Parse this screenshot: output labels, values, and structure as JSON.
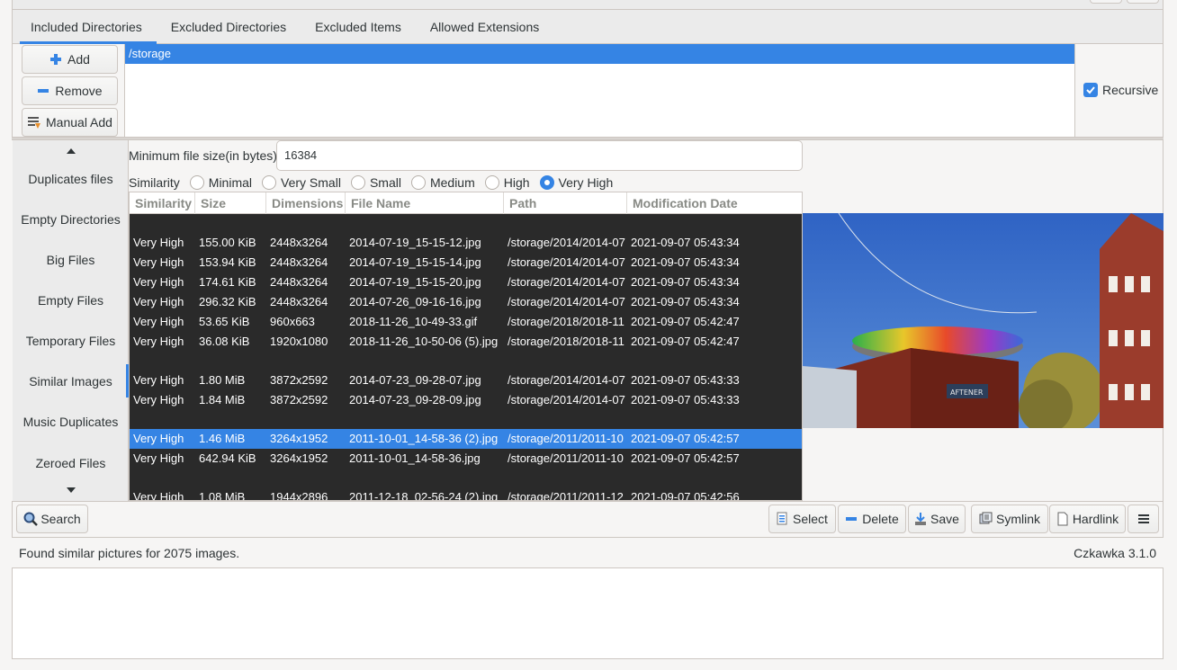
{
  "tabs": [
    "Included Directories",
    "Excluded Directories",
    "Excluded Items",
    "Allowed Extensions"
  ],
  "dir_buttons": {
    "add": "Add",
    "remove": "Remove",
    "manual_add": "Manual Add"
  },
  "directories": [
    "/storage"
  ],
  "recursive_label": "Recursive",
  "sidebar": {
    "items": [
      "Duplicates files",
      "Empty Directories",
      "Big Files",
      "Empty Files",
      "Temporary Files",
      "Similar Images",
      "Music Duplicates",
      "Zeroed Files"
    ],
    "active": "Similar Images"
  },
  "min_size": {
    "label": "Minimum file size(in bytes)",
    "value": "16384"
  },
  "similarity": {
    "label": "Similarity",
    "options": [
      "Minimal",
      "Very Small",
      "Small",
      "Medium",
      "High",
      "Very High"
    ],
    "selected": "Very High"
  },
  "table": {
    "columns": [
      "Similarity",
      "Size",
      "Dimensions",
      "File Name",
      "Path",
      "Modification Date"
    ],
    "rows": [
      {
        "sep": true
      },
      {
        "sim": "Very High",
        "size": "155.00 KiB",
        "dim": "2448x3264",
        "name": "2014-07-19_15-15-12.jpg",
        "path": "/storage/2014/2014-07",
        "date": "2021-09-07 05:43:34"
      },
      {
        "sim": "Very High",
        "size": "153.94 KiB",
        "dim": "2448x3264",
        "name": "2014-07-19_15-15-14.jpg",
        "path": "/storage/2014/2014-07",
        "date": "2021-09-07 05:43:34"
      },
      {
        "sim": "Very High",
        "size": "174.61 KiB",
        "dim": "2448x3264",
        "name": "2014-07-19_15-15-20.jpg",
        "path": "/storage/2014/2014-07",
        "date": "2021-09-07 05:43:34"
      },
      {
        "sim": "Very High",
        "size": "296.32 KiB",
        "dim": "2448x3264",
        "name": "2014-07-26_09-16-16.jpg",
        "path": "/storage/2014/2014-07",
        "date": "2021-09-07 05:43:34"
      },
      {
        "sim": "Very High",
        "size": "53.65 KiB",
        "dim": "960x663",
        "name": "2018-11-26_10-49-33.gif",
        "path": "/storage/2018/2018-11",
        "date": "2021-09-07 05:42:47"
      },
      {
        "sim": "Very High",
        "size": "36.08 KiB",
        "dim": "1920x1080",
        "name": "2018-11-26_10-50-06 (5).jpg",
        "path": "/storage/2018/2018-11",
        "date": "2021-09-07 05:42:47"
      },
      {
        "sep": true
      },
      {
        "sim": "Very High",
        "size": "1.80 MiB",
        "dim": "3872x2592",
        "name": "2014-07-23_09-28-07.jpg",
        "path": "/storage/2014/2014-07",
        "date": "2021-09-07 05:43:33"
      },
      {
        "sim": "Very High",
        "size": "1.84 MiB",
        "dim": "3872x2592",
        "name": "2014-07-23_09-28-09.jpg",
        "path": "/storage/2014/2014-07",
        "date": "2021-09-07 05:43:33"
      },
      {
        "sep": true
      },
      {
        "sim": "Very High",
        "size": "1.46 MiB",
        "dim": "3264x1952",
        "name": "2011-10-01_14-58-36 (2).jpg",
        "path": "/storage/2011/2011-10",
        "date": "2021-09-07 05:42:57",
        "selected": true
      },
      {
        "sim": "Very High",
        "size": "642.94 KiB",
        "dim": "3264x1952",
        "name": "2011-10-01_14-58-36.jpg",
        "path": "/storage/2011/2011-10",
        "date": "2021-09-07 05:42:57"
      },
      {
        "sep": true
      },
      {
        "sim": "Very High",
        "size": "1.08 MiB",
        "dim": "1944x2896",
        "name": "2011-12-18_02-56-24 (2).jpg",
        "path": "/storage/2011/2011-12",
        "date": "2021-09-07 05:42:56"
      }
    ]
  },
  "preview_sign_text": "AFTENER",
  "toolbar": {
    "search": "Search",
    "select": "Select",
    "delete": "Delete",
    "save": "Save",
    "symlink": "Symlink",
    "hardlink": "Hardlink"
  },
  "status": "Found similar pictures for 2075 images.",
  "version": "Czkawka 3.1.0",
  "colors": {
    "accent": "#3584e4",
    "table_bg": "#2a2a2a"
  }
}
